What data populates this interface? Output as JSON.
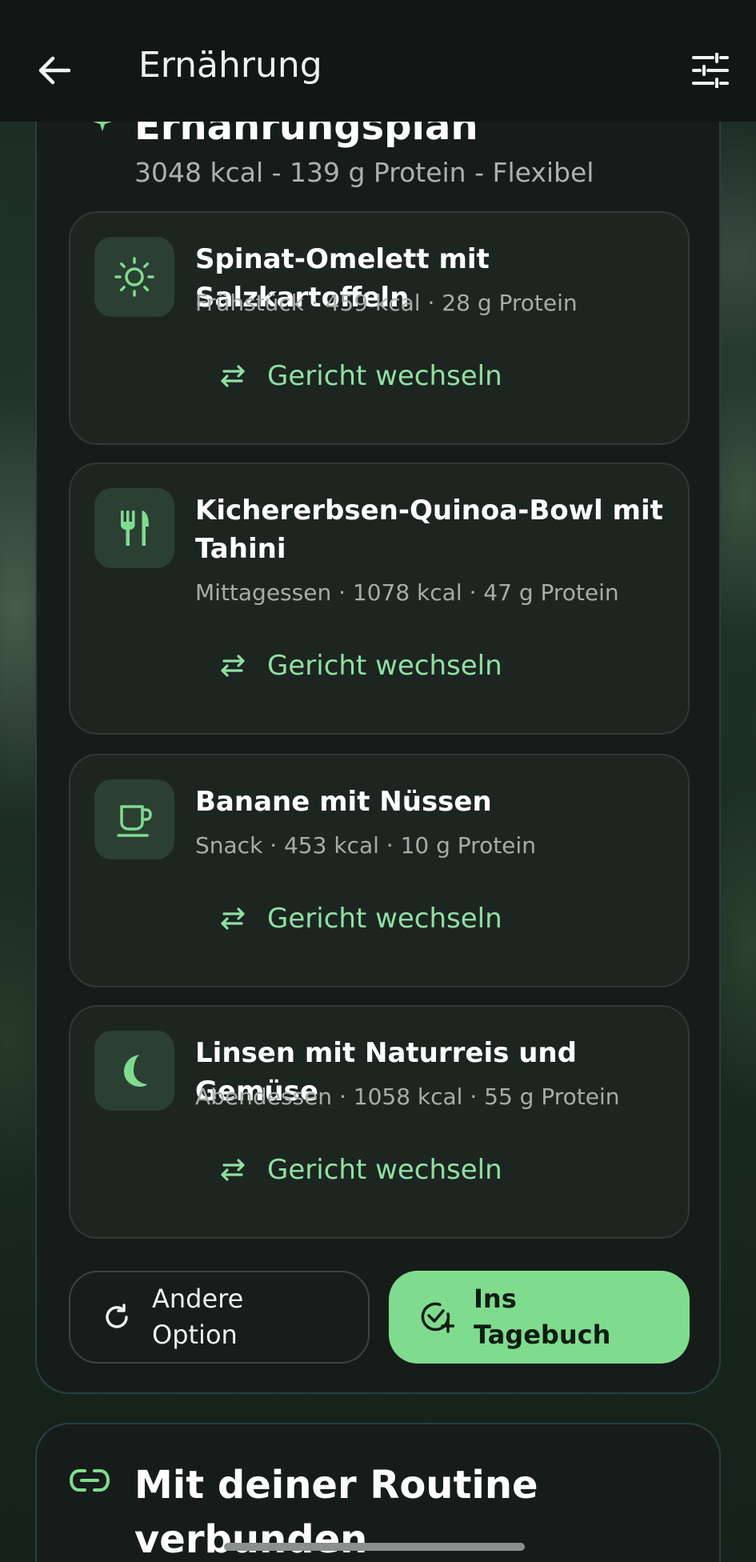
{
  "header": {
    "title": "Ernährung"
  },
  "plan": {
    "title": "Ernährungsplan",
    "subtitle": "3048 kcal - 139 g Protein - Flexibel",
    "meals": [
      {
        "name": "Spinat-Omelett mit Salzkartoffeln",
        "info": "Frühstück · 459 kcal · 28 g Protein",
        "icon": "sun-icon",
        "action": "Gericht wechseln"
      },
      {
        "name": "Kichererbsen-Quinoa-Bowl mit Tahini",
        "info": "Mittagessen · 1078 kcal · 47 g Protein",
        "icon": "cutlery-icon",
        "action": "Gericht wechseln"
      },
      {
        "name": "Banane mit Nüssen",
        "info": "Snack · 453 kcal · 10 g Protein",
        "icon": "cup-icon",
        "action": "Gericht wechseln"
      },
      {
        "name": "Linsen mit Naturreis und Gemüse",
        "info": "Abendessen · 1058 kcal · 55 g Protein",
        "icon": "moon-icon",
        "action": "Gericht wechseln"
      }
    ],
    "other_option": "Andere Option",
    "add_to_diary": "Ins Tagebuch"
  },
  "routine": {
    "title": "Mit deiner Routine verbunden"
  },
  "colors": {
    "accent": "#7fdc8f",
    "accent_text": "#8fe0a3",
    "card_bg": "#161c19",
    "meal_bg": "#1d2521"
  }
}
